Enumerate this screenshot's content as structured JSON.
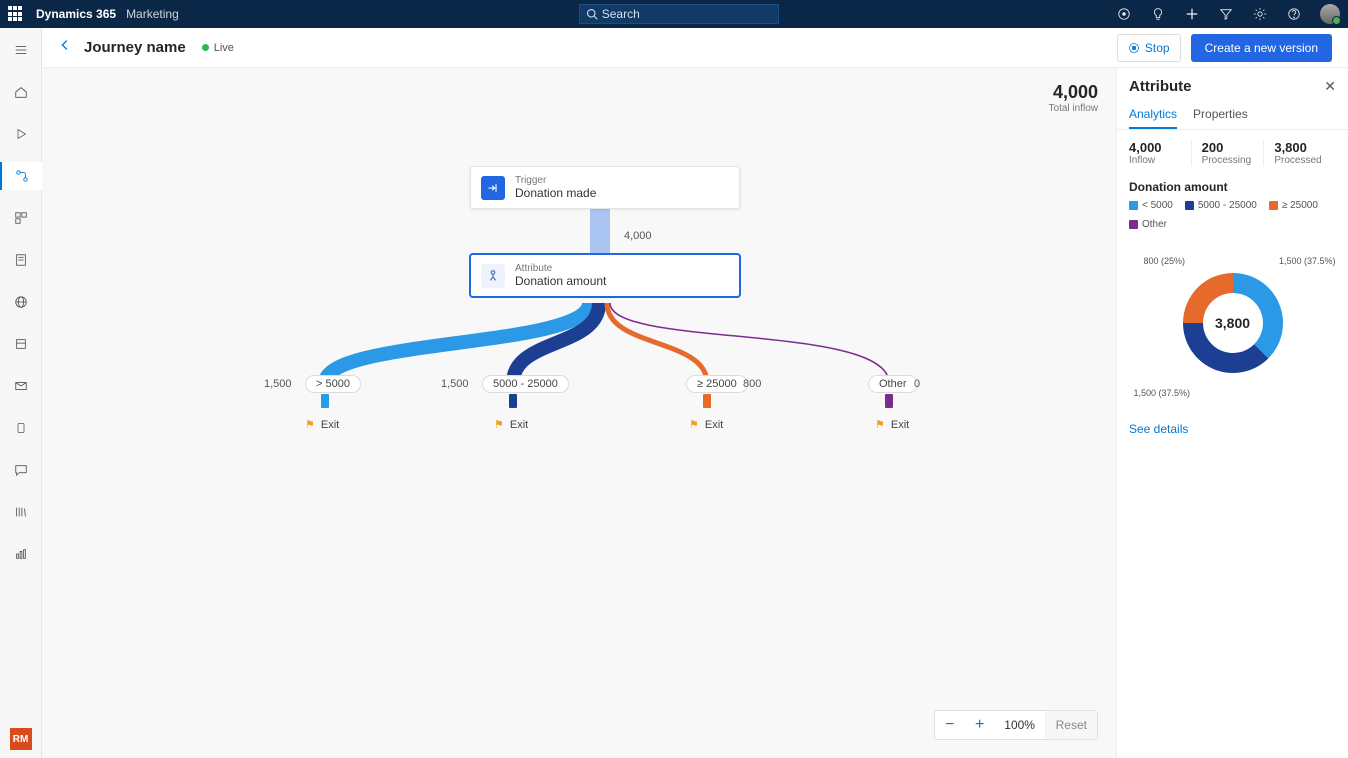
{
  "topbar": {
    "brand": "Dynamics 365",
    "module": "Marketing",
    "search_placeholder": "Search"
  },
  "header": {
    "title": "Journey name",
    "status": "Live",
    "stop_label": "Stop",
    "create_version_label": "Create a new version"
  },
  "leftnav": {
    "badge": "RM"
  },
  "canvas": {
    "total_inflow": {
      "value": "4,000",
      "label": "Total inflow"
    },
    "trigger": {
      "type": "Trigger",
      "name": "Donation made"
    },
    "trigger_out_count": "4,000",
    "attribute": {
      "type": "Attribute",
      "name": "Donation amount"
    },
    "branches": [
      {
        "label": "> 5000",
        "count": "1,500",
        "color": "#2b99e6",
        "pill_x": 263,
        "count_x": 222,
        "stub_x": 279,
        "exit_x": 263
      },
      {
        "label": "5000 - 25000",
        "count": "1,500",
        "color": "#1c3f94",
        "pill_x": 440,
        "count_x": 399,
        "stub_x": 467,
        "exit_x": 452
      },
      {
        "label": "≥ 25000",
        "count": "800",
        "color": "#e56a2b",
        "pill_x": 644,
        "count_x": 701,
        "stub_x": 661,
        "exit_x": 647
      },
      {
        "label": "Other",
        "count": "0",
        "color": "#7b2d8e",
        "pill_x": 826,
        "count_x": 872,
        "stub_x": 843,
        "exit_x": 833
      }
    ],
    "exit_label": "Exit",
    "zoom": {
      "value": "100%",
      "reset": "Reset"
    }
  },
  "panel": {
    "title": "Attribute",
    "tabs": {
      "analytics": "Analytics",
      "properties": "Properties"
    },
    "metrics": [
      {
        "value": "4,000",
        "label": "Inflow"
      },
      {
        "value": "200",
        "label": "Processing"
      },
      {
        "value": "3,800",
        "label": "Processed"
      }
    ],
    "chart_title": "Donation amount",
    "see_details": "See details"
  },
  "chart_data": {
    "type": "pie",
    "title": "Donation amount",
    "center_value": "3,800",
    "series": [
      {
        "name": "< 5000",
        "value": 1500,
        "pct": 37.5,
        "label": "1,500 (37.5%)",
        "color": "#2b99e6"
      },
      {
        "name": "5000 - 25000",
        "value": 1500,
        "pct": 37.5,
        "label": "1,500 (37.5%)",
        "color": "#1c3f94"
      },
      {
        "name": "≥ 25000",
        "value": 800,
        "pct": 25,
        "label": "800 (25%)",
        "color": "#e56a2b"
      },
      {
        "name": "Other",
        "value": 0,
        "pct": 0,
        "label": "",
        "color": "#7b2d8e"
      }
    ]
  }
}
